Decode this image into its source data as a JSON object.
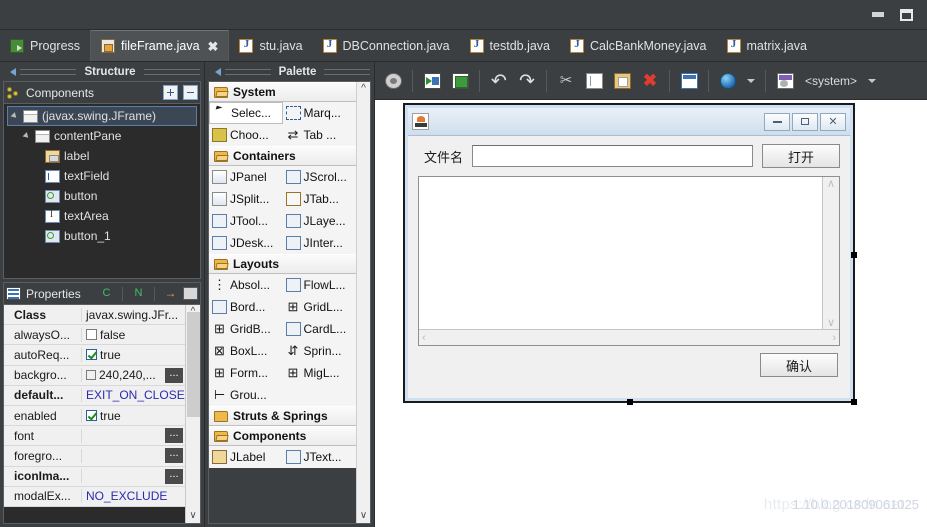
{
  "window": {
    "minimize_label": "minimize",
    "maximize_label": "maximize"
  },
  "tabs": [
    {
      "label": "Progress",
      "icon": "progress-icon",
      "active": false,
      "closable": false
    },
    {
      "label": "fileFrame.java",
      "icon": "designer-icon",
      "active": true,
      "closable": true,
      "close_glyph": "✖"
    },
    {
      "label": "stu.java",
      "icon": "java-file-icon",
      "active": false,
      "closable": false
    },
    {
      "label": "DBConnection.java",
      "icon": "java-file-icon",
      "active": false,
      "closable": false
    },
    {
      "label": "testdb.java",
      "icon": "java-file-icon",
      "active": false,
      "closable": false
    },
    {
      "label": "CalcBankMoney.java",
      "icon": "java-file-icon",
      "active": false,
      "closable": false
    },
    {
      "label": "matrix.java",
      "icon": "java-file-icon",
      "active": false,
      "closable": false
    }
  ],
  "structure": {
    "title": "Structure",
    "components_panel": {
      "title": "Components",
      "expand_all_label": "+",
      "collapse_all_label": "−",
      "tree": [
        {
          "label": "(javax.swing.JFrame)",
          "depth": 0,
          "icon": "frame-icon",
          "twisty": true,
          "selected": true
        },
        {
          "label": "contentPane",
          "depth": 1,
          "icon": "frame-icon",
          "twisty": true,
          "selected": false
        },
        {
          "label": "label",
          "depth": 2,
          "icon": "jlabel-icon",
          "twisty": false,
          "selected": false
        },
        {
          "label": "textField",
          "depth": 2,
          "icon": "jtextfield-icon",
          "twisty": false,
          "selected": false
        },
        {
          "label": "button",
          "depth": 2,
          "icon": "jbutton-icon",
          "twisty": false,
          "selected": false
        },
        {
          "label": "textArea",
          "depth": 2,
          "icon": "jtextarea-icon",
          "twisty": false,
          "selected": false
        },
        {
          "label": "button_1",
          "depth": 2,
          "icon": "jbutton-icon",
          "twisty": false,
          "selected": false
        }
      ]
    }
  },
  "properties": {
    "title": "Properties",
    "toolbar_icons": [
      "show-components-icon",
      "show-events-icon",
      "sort-icon",
      "filter-icon"
    ],
    "rows": [
      {
        "name": "Class",
        "value": "javax.swing.JFr...",
        "bold": true,
        "kind": "text"
      },
      {
        "name": "alwaysO...",
        "value": "false",
        "bold": false,
        "kind": "checkbox",
        "checked": false
      },
      {
        "name": "autoReq...",
        "value": "true",
        "bold": false,
        "kind": "checkbox",
        "checked": true
      },
      {
        "name": "backgro...",
        "value": "240,240,...",
        "bold": false,
        "kind": "color"
      },
      {
        "name": "default...",
        "value": "EXIT_ON_CLOSE",
        "bold": true,
        "kind": "blue"
      },
      {
        "name": "enabled",
        "value": "true",
        "bold": false,
        "kind": "checkbox",
        "checked": true
      },
      {
        "name": "font",
        "value": "",
        "bold": false,
        "kind": "editor"
      },
      {
        "name": "foregro...",
        "value": "",
        "bold": false,
        "kind": "editor"
      },
      {
        "name": "iconIma...",
        "value": "",
        "bold": true,
        "kind": "editor"
      },
      {
        "name": "modalEx...",
        "value": "NO_EXCLUDE",
        "bold": false,
        "kind": "blue"
      }
    ],
    "editor_button_label": "..."
  },
  "palette": {
    "title": "Palette",
    "groups": [
      {
        "name": "System",
        "open": true,
        "items": [
          {
            "label": "Selec...",
            "icon": "cursor-icon",
            "selected": true
          },
          {
            "label": "Marq...",
            "icon": "marquee-icon",
            "selected": false
          },
          {
            "label": "Choo...",
            "icon": "choose-component-icon",
            "selected": false
          },
          {
            "label": "Tab ...",
            "icon": "tab-order-icon",
            "selected": false
          }
        ]
      },
      {
        "name": "Containers",
        "open": true,
        "items": [
          {
            "label": "JPanel",
            "icon": "jpanel-icon",
            "selected": false
          },
          {
            "label": "JScrol...",
            "icon": "jscrollpane-icon",
            "selected": false
          },
          {
            "label": "JSplit...",
            "icon": "jsplitpane-icon",
            "selected": false
          },
          {
            "label": "JTab...",
            "icon": "jtabbedpane-icon",
            "selected": false
          },
          {
            "label": "JTool...",
            "icon": "jtoolbar-icon",
            "selected": false
          },
          {
            "label": "JLaye...",
            "icon": "jlayeredpane-icon",
            "selected": false
          },
          {
            "label": "JDesk...",
            "icon": "jdesktoppane-icon",
            "selected": false
          },
          {
            "label": "JInter...",
            "icon": "jinternalframe-icon",
            "selected": false
          }
        ]
      },
      {
        "name": "Layouts",
        "open": true,
        "items": [
          {
            "label": "Absol...",
            "icon": "absolute-layout-icon",
            "selected": false
          },
          {
            "label": "FlowL...",
            "icon": "flowlayout-icon",
            "selected": false
          },
          {
            "label": "Bord...",
            "icon": "borderlayout-icon",
            "selected": false
          },
          {
            "label": "GridL...",
            "icon": "gridlayout-icon",
            "selected": false
          },
          {
            "label": "GridB...",
            "icon": "gridbaglayout-icon",
            "selected": false
          },
          {
            "label": "CardL...",
            "icon": "cardlayout-icon",
            "selected": false
          },
          {
            "label": "BoxL...",
            "icon": "boxlayout-icon",
            "selected": false
          },
          {
            "label": "Sprin...",
            "icon": "springlayout-icon",
            "selected": false
          },
          {
            "label": "Form...",
            "icon": "formlayout-icon",
            "selected": false
          },
          {
            "label": "MigL...",
            "icon": "miglayout-icon",
            "selected": false
          },
          {
            "label": "Grou...",
            "icon": "grouplayout-icon",
            "selected": false
          }
        ]
      },
      {
        "name": "Struts & Springs",
        "open": false,
        "items": []
      },
      {
        "name": "Components",
        "open": true,
        "items": [
          {
            "label": "JLabel",
            "icon": "jlabel-icon",
            "selected": false
          },
          {
            "label": "JText...",
            "icon": "jtextfield-icon",
            "selected": false
          }
        ]
      }
    ]
  },
  "toolbar": {
    "buttons": [
      {
        "name": "properties-icon",
        "label": ""
      },
      {
        "name": "test-run-icon",
        "label": ""
      },
      {
        "name": "refresh-icon",
        "label": ""
      },
      {
        "name": "undo-icon",
        "label": "↶"
      },
      {
        "name": "redo-icon",
        "label": "↷"
      },
      {
        "name": "cut-icon",
        "label": "✂"
      },
      {
        "name": "copy-icon",
        "label": ""
      },
      {
        "name": "paste-icon",
        "label": ""
      },
      {
        "name": "delete-icon",
        "label": "✖"
      },
      {
        "name": "layout-icon",
        "label": ""
      },
      {
        "name": "externalize-strings-icon",
        "label": ""
      }
    ],
    "lookandfeel_value": "<system>",
    "dropdown_glyph": "▾"
  },
  "design": {
    "frame": {
      "app_icon": "java-coffee-icon",
      "minimize_glyph": "—",
      "maximize_glyph": "□",
      "close_glyph": "✕",
      "label_text": "文件名",
      "textfield_value": "",
      "open_button": "打开",
      "textarea_value": "",
      "confirm_button": "确认",
      "scroll_up_glyph": "∧",
      "scroll_down_glyph": "∨",
      "scroll_left_glyph": "‹",
      "scroll_right_glyph": "›"
    }
  },
  "watermark": {
    "url": "https://blog.csdn.net",
    "version": "1.10.0.201809061025"
  }
}
